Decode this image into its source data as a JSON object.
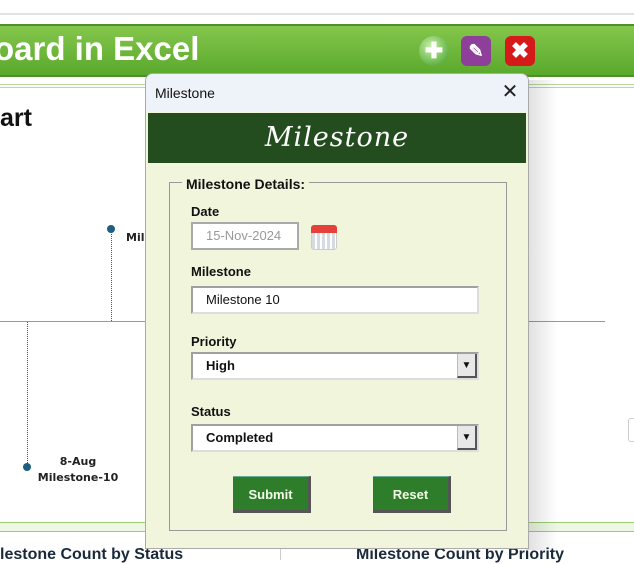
{
  "banner": {
    "title": "oard in Excel",
    "icons": [
      "add-icon",
      "edit-icon",
      "close-icon"
    ]
  },
  "chart": {
    "title": "art",
    "points": [
      {
        "label_top": "",
        "label": "Mil"
      },
      {
        "label_top": "8-Aug",
        "label": "Milestone-10"
      }
    ]
  },
  "bottom": {
    "left_title": "lestone Count by Status",
    "right_title": "Milestone Count by Priority"
  },
  "dialog": {
    "window_title": "Milestone",
    "header": "Milestone",
    "group_label": "Milestone Details:",
    "date": {
      "label": "Date",
      "value": "15-Nov-2024"
    },
    "milestone": {
      "label": "Milestone",
      "value": "Milestone 10"
    },
    "priority": {
      "label": "Priority",
      "value": "High"
    },
    "status": {
      "label": "Status",
      "value": "Completed"
    },
    "submit_label": "Submit",
    "reset_label": "Reset"
  },
  "colors": {
    "banner": "#6bb83a",
    "header": "#234d1e",
    "button": "#2e7d2a",
    "body": "#f0f5dc",
    "marker": "#1d5f80"
  }
}
